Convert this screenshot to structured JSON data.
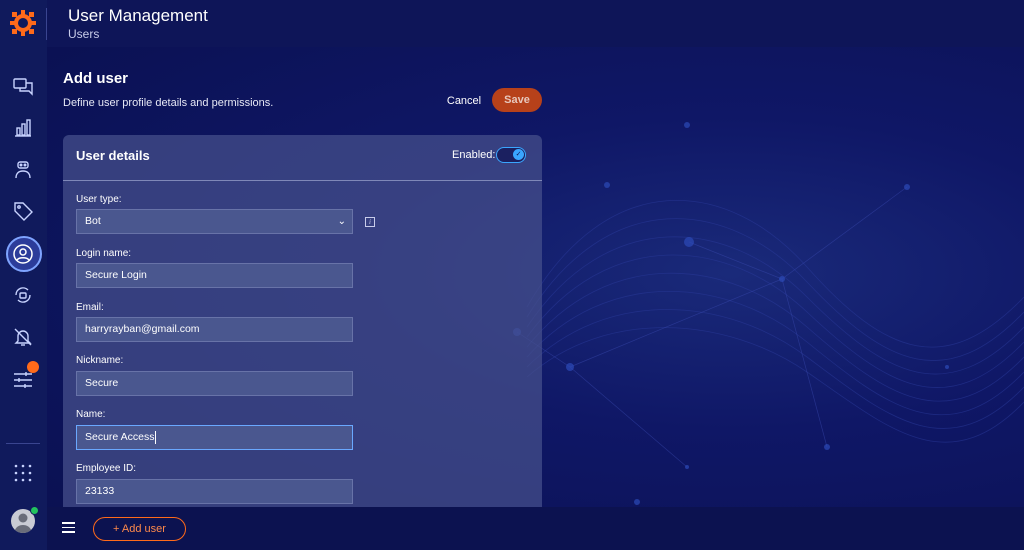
{
  "header": {
    "app_title": "User Management",
    "breadcrumb": "Users"
  },
  "sidebar": {
    "items": [
      {
        "icon": "chat-icon"
      },
      {
        "icon": "bar-chart-icon"
      },
      {
        "icon": "bot-icon"
      },
      {
        "icon": "tag-icon"
      },
      {
        "icon": "user-circle-icon",
        "active": true
      },
      {
        "icon": "refresh-bot-icon"
      },
      {
        "icon": "bell-off-icon"
      },
      {
        "icon": "sliders-icon",
        "badge": true
      },
      {
        "icon": "grid-dots-icon"
      }
    ],
    "avatar_status": "online"
  },
  "page": {
    "title": "Add user",
    "description": "Define user profile details and permissions.",
    "cancel_label": "Cancel",
    "save_label": "Save"
  },
  "card": {
    "title": "User details",
    "enabled_label": "Enabled:",
    "enabled": true,
    "fields": [
      {
        "label": "User type:",
        "value": "Bot"
      },
      {
        "label": "Login name:",
        "value": "Secure Login"
      },
      {
        "label": "Email:",
        "value": "harryrayban@gmail.com"
      },
      {
        "label": "Nickname:",
        "value": "Secure"
      },
      {
        "label": "Name:",
        "value": "Secure Access"
      },
      {
        "label": "Employee ID:",
        "value": "23133"
      }
    ]
  },
  "footer": {
    "add_user_label": "+ Add user"
  },
  "colors": {
    "accent": "#ff6a1a",
    "toggle": "#3aa6ff",
    "background": "#0c1250"
  }
}
